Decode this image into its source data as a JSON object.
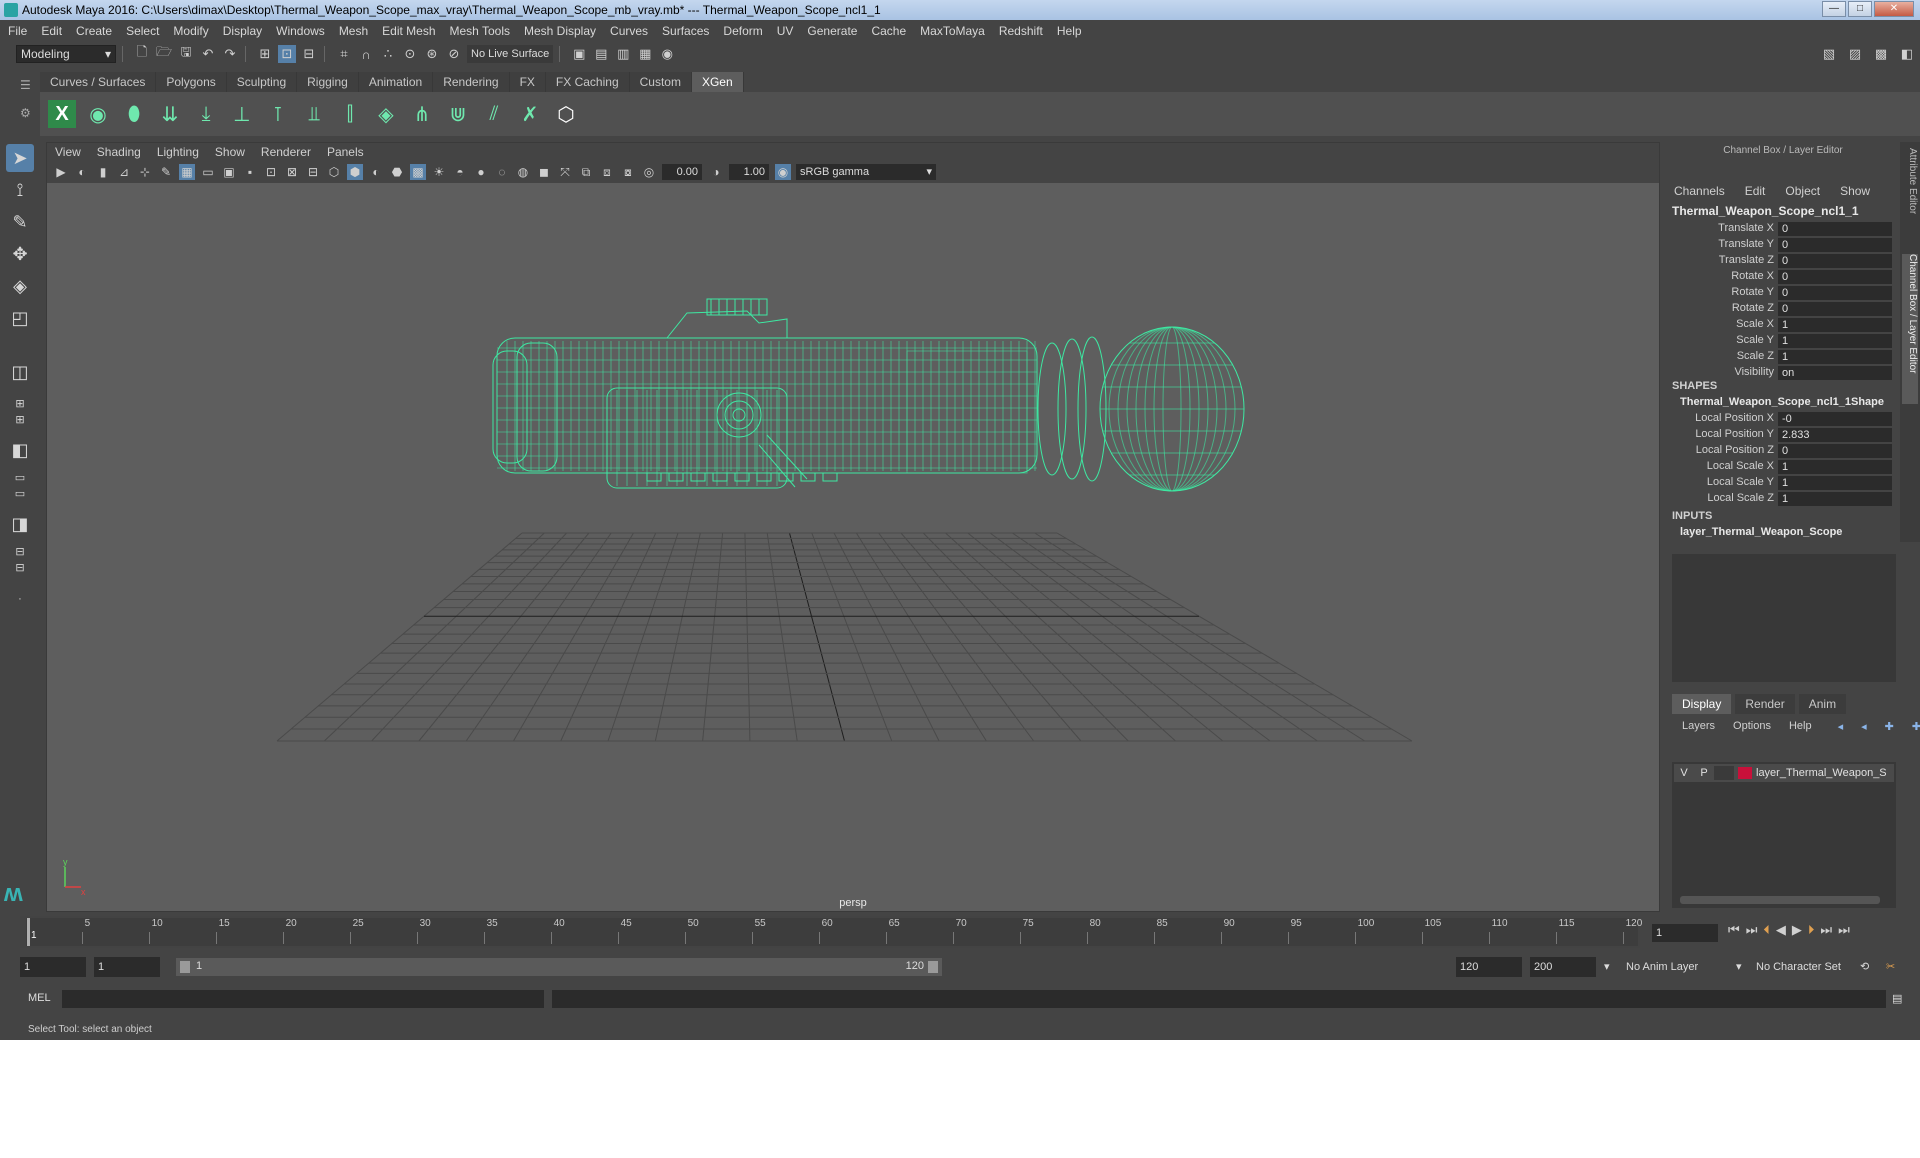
{
  "window": {
    "title": "Autodesk Maya 2016: C:\\Users\\dimax\\Desktop\\Thermal_Weapon_Scope_max_vray\\Thermal_Weapon_Scope_mb_vray.mb*   ---   Thermal_Weapon_Scope_ncl1_1",
    "minimize": "—",
    "maximize": "□",
    "close": "✕"
  },
  "menubar": [
    "File",
    "Edit",
    "Create",
    "Select",
    "Modify",
    "Display",
    "Windows",
    "Mesh",
    "Edit Mesh",
    "Mesh Tools",
    "Mesh Display",
    "Curves",
    "Surfaces",
    "Deform",
    "UV",
    "Generate",
    "Cache",
    "MaxToMaya",
    "Redshift",
    "Help"
  ],
  "statusline": {
    "mode": "Modeling",
    "live_surface": "No Live Surface"
  },
  "shelf": {
    "tabs": [
      "Curves / Surfaces",
      "Polygons",
      "Sculpting",
      "Rigging",
      "Animation",
      "Rendering",
      "FX",
      "FX Caching",
      "Custom",
      "XGen"
    ],
    "active_tab": "XGen"
  },
  "viewport": {
    "menu": [
      "View",
      "Shading",
      "Lighting",
      "Show",
      "Renderer",
      "Panels"
    ],
    "exposure": "0.00",
    "gamma": "1.00",
    "color_space": "sRGB gamma",
    "camera": "persp",
    "wire_color": "#3ee8a2",
    "axis_y": "y",
    "axis_x": "x"
  },
  "channel_box": {
    "title": "Channel Box / Layer Editor",
    "menu": [
      "Channels",
      "Edit",
      "Object",
      "Show"
    ],
    "object": "Thermal_Weapon_Scope_ncl1_1",
    "channels": [
      {
        "label": "Translate X",
        "value": "0"
      },
      {
        "label": "Translate Y",
        "value": "0"
      },
      {
        "label": "Translate Z",
        "value": "0"
      },
      {
        "label": "Rotate X",
        "value": "0"
      },
      {
        "label": "Rotate Y",
        "value": "0"
      },
      {
        "label": "Rotate Z",
        "value": "0"
      },
      {
        "label": "Scale X",
        "value": "1"
      },
      {
        "label": "Scale Y",
        "value": "1"
      },
      {
        "label": "Scale Z",
        "value": "1"
      },
      {
        "label": "Visibility",
        "value": "on"
      }
    ],
    "shapes_header": "SHAPES",
    "shape_name": "Thermal_Weapon_Scope_ncl1_1Shape",
    "shape_channels": [
      {
        "label": "Local Position X",
        "value": "-0"
      },
      {
        "label": "Local Position Y",
        "value": "2.833"
      },
      {
        "label": "Local Position Z",
        "value": "0"
      },
      {
        "label": "Local Scale X",
        "value": "1"
      },
      {
        "label": "Local Scale Y",
        "value": "1"
      },
      {
        "label": "Local Scale Z",
        "value": "1"
      }
    ],
    "inputs_header": "INPUTS",
    "input_name": "layer_Thermal_Weapon_Scope",
    "side_tabs": [
      "Attribute Editor",
      "Channel Box / Layer Editor"
    ]
  },
  "layer_editor": {
    "tabs": [
      "Display",
      "Render",
      "Anim"
    ],
    "active_tab": "Display",
    "menu": [
      "Layers",
      "Options",
      "Help"
    ],
    "layer": {
      "v": "V",
      "p": "P",
      "name": "layer_Thermal_Weapon_S",
      "color": "#c8103a"
    }
  },
  "timeline": {
    "ticks": [
      1,
      5,
      10,
      15,
      20,
      25,
      30,
      35,
      40,
      45,
      50,
      55,
      60,
      65,
      70,
      75,
      80,
      85,
      90,
      95,
      100,
      105,
      110,
      115,
      120
    ],
    "current_frame": "1"
  },
  "range": {
    "start": "1",
    "playback_start": "1",
    "range_start_label": "1",
    "range_end_label": "120",
    "playback_end": "120",
    "end": "200",
    "anim_layer": "No Anim Layer",
    "character_set": "No Character Set"
  },
  "command_line": {
    "label": "MEL"
  },
  "help_line": "Select Tool: select an object"
}
